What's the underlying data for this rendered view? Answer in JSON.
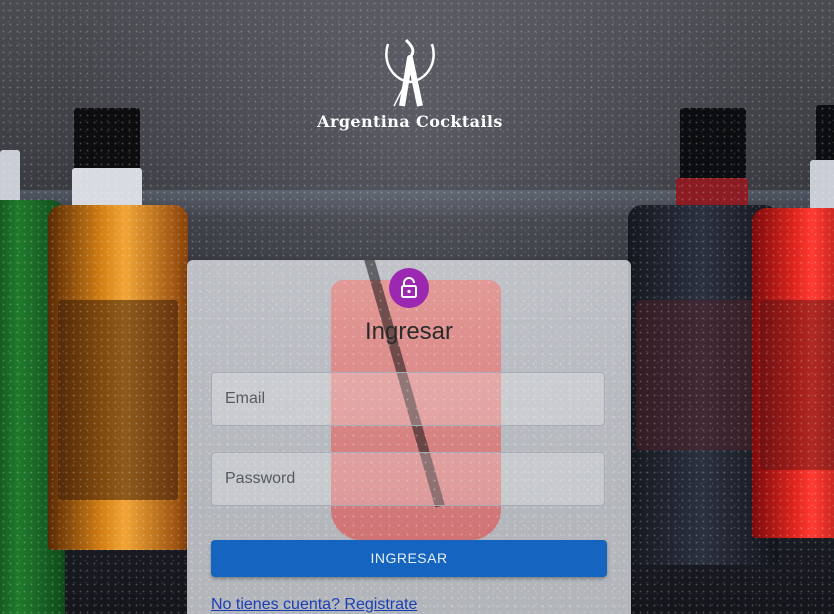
{
  "brand": {
    "name": "Argentina Cocktails",
    "logo_icon": "cocktail-glass-a-logo"
  },
  "login": {
    "icon": "lock-icon",
    "title": "Ingresar",
    "email_placeholder": "Email",
    "password_placeholder": "Password",
    "submit_label": "INGRESAR",
    "register_link": "No tienes cuenta? Registrate"
  },
  "colors": {
    "avatar_bg": "#9c27b0",
    "primary": "#1565c0",
    "link": "#1a3fb5"
  }
}
